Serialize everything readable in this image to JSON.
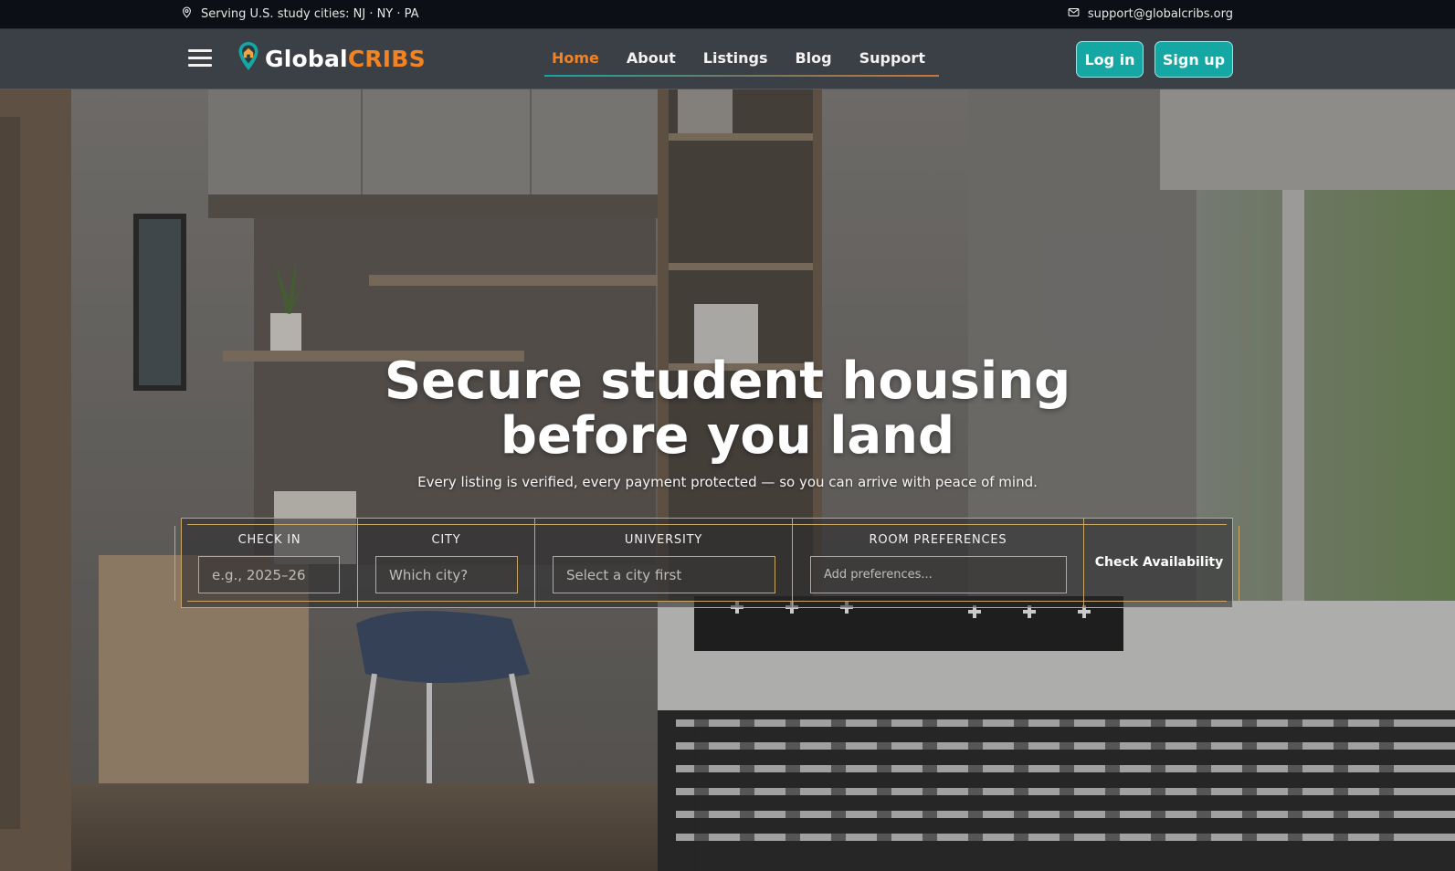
{
  "topbar": {
    "location": "Serving U.S. study cities: NJ · NY · PA",
    "email": "support@globalcribs.org",
    "location_icon": "map-pin-icon",
    "email_icon": "mail-icon"
  },
  "brand": {
    "name_part1": "Global",
    "name_part2": "CRIBS",
    "primary_color": "#15a7a3",
    "accent_color": "#f28322"
  },
  "nav": {
    "items": [
      {
        "label": "Home",
        "active": true
      },
      {
        "label": "About"
      },
      {
        "label": "Listings"
      },
      {
        "label": "Blog"
      },
      {
        "label": "Support"
      }
    ]
  },
  "auth": {
    "login_label": "Log in",
    "signup_label": "Sign up"
  },
  "hero": {
    "title_line1": "Secure student housing",
    "title_line2": "before you land",
    "subtitle": "Every listing is verified, every payment protected — so you can arrive with peace of mind."
  },
  "search": {
    "check_in": {
      "label": "CHECK IN",
      "placeholder": "e.g., 2025–26"
    },
    "city": {
      "label": "CITY",
      "placeholder": "Which city?"
    },
    "university": {
      "label": "UNIVERSITY",
      "placeholder": "Select a city first"
    },
    "room_preferences": {
      "label": "ROOM PREFERENCES",
      "placeholder": "Add preferences..."
    },
    "submit_label": "Check Availability"
  }
}
